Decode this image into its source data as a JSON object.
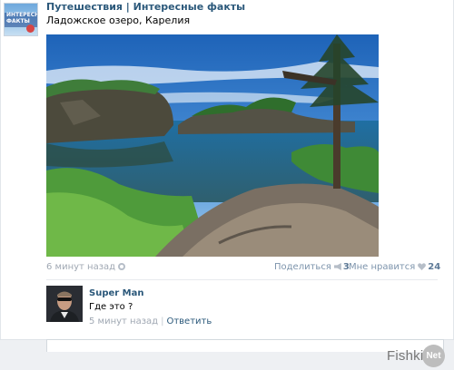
{
  "post": {
    "group_name": "Путешествия | Интересные факты",
    "group_avatar_text": "ИНТЕРЕСНЫЕ ФАКТЫ",
    "text": "Ладожское озеро, Карелия",
    "time": "6 минут назад",
    "share_label": "Поделиться",
    "share_count": "3",
    "like_label": "Мне нравится",
    "like_count": "24"
  },
  "comment": {
    "author": "Super Man",
    "text": "Где это ?",
    "time": "5 минут назад",
    "separator": "|",
    "reply_label": "Ответить"
  },
  "watermark": {
    "text": "Fishki",
    "badge": "Net"
  },
  "icons": {
    "settings": "gear-icon",
    "share": "megaphone-icon",
    "like": "heart-icon"
  },
  "colors": {
    "link": "#2b587a",
    "meta": "#a0a8b3",
    "action": "#7d94ac"
  }
}
